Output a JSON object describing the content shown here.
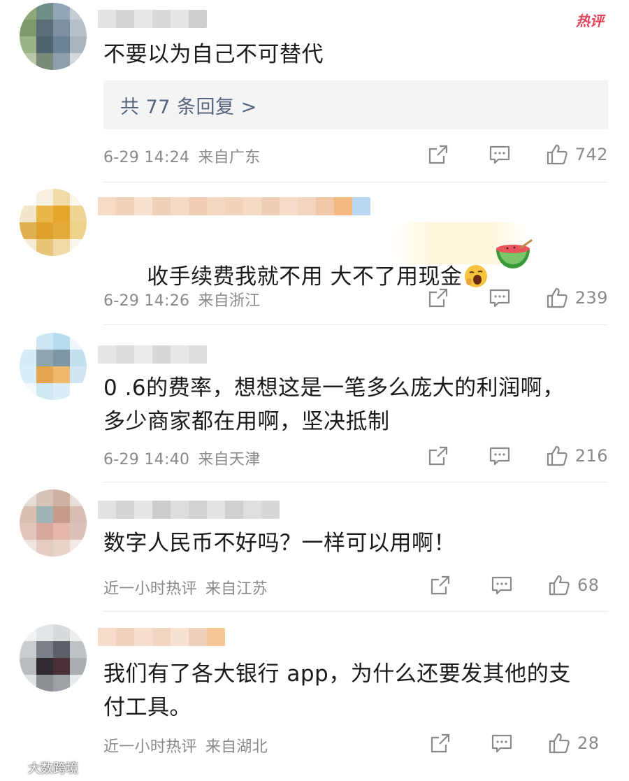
{
  "hot_badge": "热评",
  "comments": [
    {
      "text": "不要以为自己不可替代",
      "replies": "共 77 条回复 >",
      "time": "6-29 14:24",
      "location": "来自广东",
      "likes": "742"
    },
    {
      "text": "收手续费我就不用 大不了用现金",
      "time": "6-29 14:26",
      "location": "来自浙江",
      "likes": "239"
    },
    {
      "text": "0 .6的费率，想想这是一笔多么庞大的利润啊，\n多少商家都在用啊，坚决抵制",
      "time": "6-29 14:40",
      "location": "来自天津",
      "likes": "216"
    },
    {
      "text": "数字人民币不好吗？一样可以用啊！",
      "time": "近一小时热评",
      "location": "来自江苏",
      "likes": "68"
    },
    {
      "text": "我们有了各大银行 app，为什么还要发其他的支\n付工具。",
      "time": "近一小时热评",
      "location": "来自湖北",
      "likes": "28"
    }
  ],
  "icons": {
    "share": "share-icon",
    "comment": "comment-icon",
    "like": "thumbs-up-icon",
    "emoji_yawn": "yawning-face-icon",
    "emoji_melon": "watermelon-icon"
  },
  "watermark": "大数跨境",
  "colors": {
    "reply_link": "#55657e",
    "meta": "#8a8a8a",
    "hot_badge": "#e0455b"
  }
}
